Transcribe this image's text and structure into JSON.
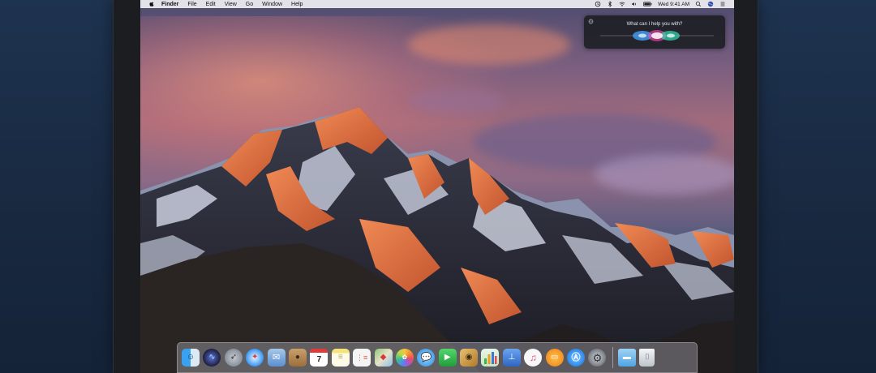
{
  "menubar": {
    "app_name": "Finder",
    "menus": [
      "File",
      "Edit",
      "View",
      "Go",
      "Window",
      "Help"
    ],
    "clock": "Wed 9:41 AM"
  },
  "siri": {
    "prompt": "What can I help you with?"
  },
  "dock": {
    "apps": [
      {
        "name": "Finder",
        "icon": "finder-icon",
        "color": "#3aa0f0"
      },
      {
        "name": "Siri",
        "icon": "siri-icon",
        "color": "#1b1f3a"
      },
      {
        "name": "Launchpad",
        "icon": "launchpad-icon",
        "color": "#8d97a3"
      },
      {
        "name": "Safari",
        "icon": "safari-icon",
        "color": "#2a8ef2"
      },
      {
        "name": "Mail",
        "icon": "mail-icon",
        "color": "#6aa6e0"
      },
      {
        "name": "Contacts",
        "icon": "contacts-icon",
        "color": "#b88a55"
      },
      {
        "name": "Calendar",
        "icon": "calendar-icon",
        "color": "#ffffff",
        "day": "7"
      },
      {
        "name": "Notes",
        "icon": "notes-icon",
        "color": "#f4e27a"
      },
      {
        "name": "Reminders",
        "icon": "reminders-icon",
        "color": "#f4f4f4"
      },
      {
        "name": "Maps",
        "icon": "maps-icon",
        "color": "#8cc77a"
      },
      {
        "name": "Photos",
        "icon": "photos-icon",
        "color": "#f2f2f2"
      },
      {
        "name": "Messages",
        "icon": "messages-icon",
        "color": "#5fb6f4"
      },
      {
        "name": "FaceTime",
        "icon": "facetime-icon",
        "color": "#2fbf4a"
      },
      {
        "name": "Photo Booth",
        "icon": "photo-booth-icon",
        "color": "#d9a44a"
      },
      {
        "name": "Numbers",
        "icon": "numbers-icon",
        "color": "#3fb04a"
      },
      {
        "name": "Keynote",
        "icon": "keynote-icon",
        "color": "#3a7ad8"
      },
      {
        "name": "iTunes",
        "icon": "itunes-icon",
        "color": "#f0f0f0"
      },
      {
        "name": "iBooks",
        "icon": "ibooks-icon",
        "color": "#f29a23"
      },
      {
        "name": "App Store",
        "icon": "app-store-icon",
        "color": "#2f8ff0"
      },
      {
        "name": "System Preferences",
        "icon": "system-preferences-icon",
        "color": "#8a8f96"
      }
    ],
    "folders": [
      {
        "name": "Downloads",
        "icon": "folder-icon",
        "color": "#6ab8ec"
      },
      {
        "name": "Trash",
        "icon": "trash-icon",
        "color": "#dfe3e8"
      }
    ]
  }
}
